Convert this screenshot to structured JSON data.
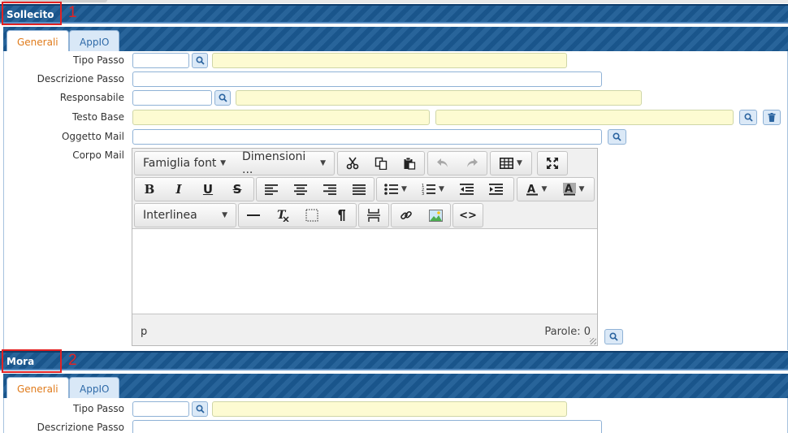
{
  "sections": [
    {
      "title": "Sollecito",
      "marker": "1",
      "tabs": [
        {
          "label": "Generali"
        },
        {
          "label": "AppIO"
        }
      ],
      "fields": {
        "tipo_passo": {
          "label": "Tipo Passo",
          "value": "",
          "description": ""
        },
        "descrizione_passo": {
          "label": "Descrizione Passo",
          "value": ""
        },
        "responsabile": {
          "label": "Responsabile",
          "value": "",
          "description": ""
        },
        "testo_base": {
          "label": "Testo Base",
          "value": "",
          "value2": ""
        },
        "oggetto_mail": {
          "label": "Oggetto Mail",
          "value": ""
        },
        "corpo_mail": {
          "label": "Corpo Mail"
        }
      }
    },
    {
      "title": "Mora",
      "marker": "2",
      "tabs": [
        {
          "label": "Generali"
        },
        {
          "label": "AppIO"
        }
      ],
      "fields": {
        "tipo_passo": {
          "label": "Tipo Passo",
          "value": "",
          "description": ""
        },
        "descrizione_passo": {
          "label": "Descrizione Passo",
          "value": ""
        }
      }
    }
  ],
  "editor": {
    "font_family": "Famiglia font",
    "font_size": "Dimensioni ...",
    "line_height": "Interlinea",
    "status_path": "p",
    "word_count": "Parole: 0",
    "icons": {
      "cut": "scissors-icon",
      "copy": "copy-icon",
      "paste": "paste-icon",
      "undo": "undo-icon",
      "redo": "redo-icon",
      "table": "table-icon",
      "fullscreen": "fullscreen-icon"
    }
  },
  "colors": {
    "header_blue": "#1b5a94",
    "tab_active_text": "#e07b1b",
    "readonly_field": "#fdfbd2",
    "marker_red": "#e32222"
  }
}
